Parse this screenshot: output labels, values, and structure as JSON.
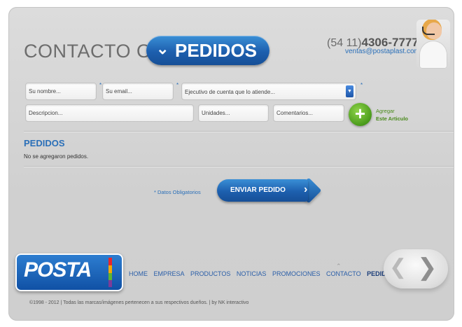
{
  "header": {
    "title_prefix": "CONTACTO O",
    "pedidos_button": "PEDIDOS",
    "phone_prefix": "(54 11)",
    "phone_number": "4306-7777",
    "email": "ventas@postaplast.com"
  },
  "form": {
    "name_placeholder": "Su nombre...",
    "email_placeholder": "Su email...",
    "executive_selected": "Ejecutivo de cuenta que lo atiende...",
    "description_placeholder": "Descripcion...",
    "units_placeholder": "Unidades...",
    "comments_placeholder": "Comentarios...",
    "required_mark": "*",
    "add_label_line1": "Agregar",
    "add_label_line2": "Este Articulo"
  },
  "orders": {
    "title": "PEDIDOS",
    "empty_text": "No se agregaron pedidos.",
    "required_note": "* Datos Obligatorios",
    "send_button": "ENVIAR PEDIDO"
  },
  "logo": {
    "text": "POSTA",
    "stripe_colors": [
      "#e8262d",
      "#f6a800",
      "#5db531",
      "#7d3c98"
    ]
  },
  "nav": {
    "items": [
      "HOME",
      "EMPRESA",
      "PRODUCTOS",
      "NOTICIAS",
      "PROMOCIONES",
      "CONTACTO",
      "PEDIDOS"
    ],
    "active": "PEDIDOS"
  },
  "footer": {
    "copyright": "©1998 - 2012 | Todas las marcas/imágenes pertenecen a sus respectivos dueños. | by NK interactivo"
  },
  "colors": {
    "accent_blue": "#1d5fae",
    "link_blue": "#2a6fb8",
    "add_green": "#4a9b1b"
  }
}
